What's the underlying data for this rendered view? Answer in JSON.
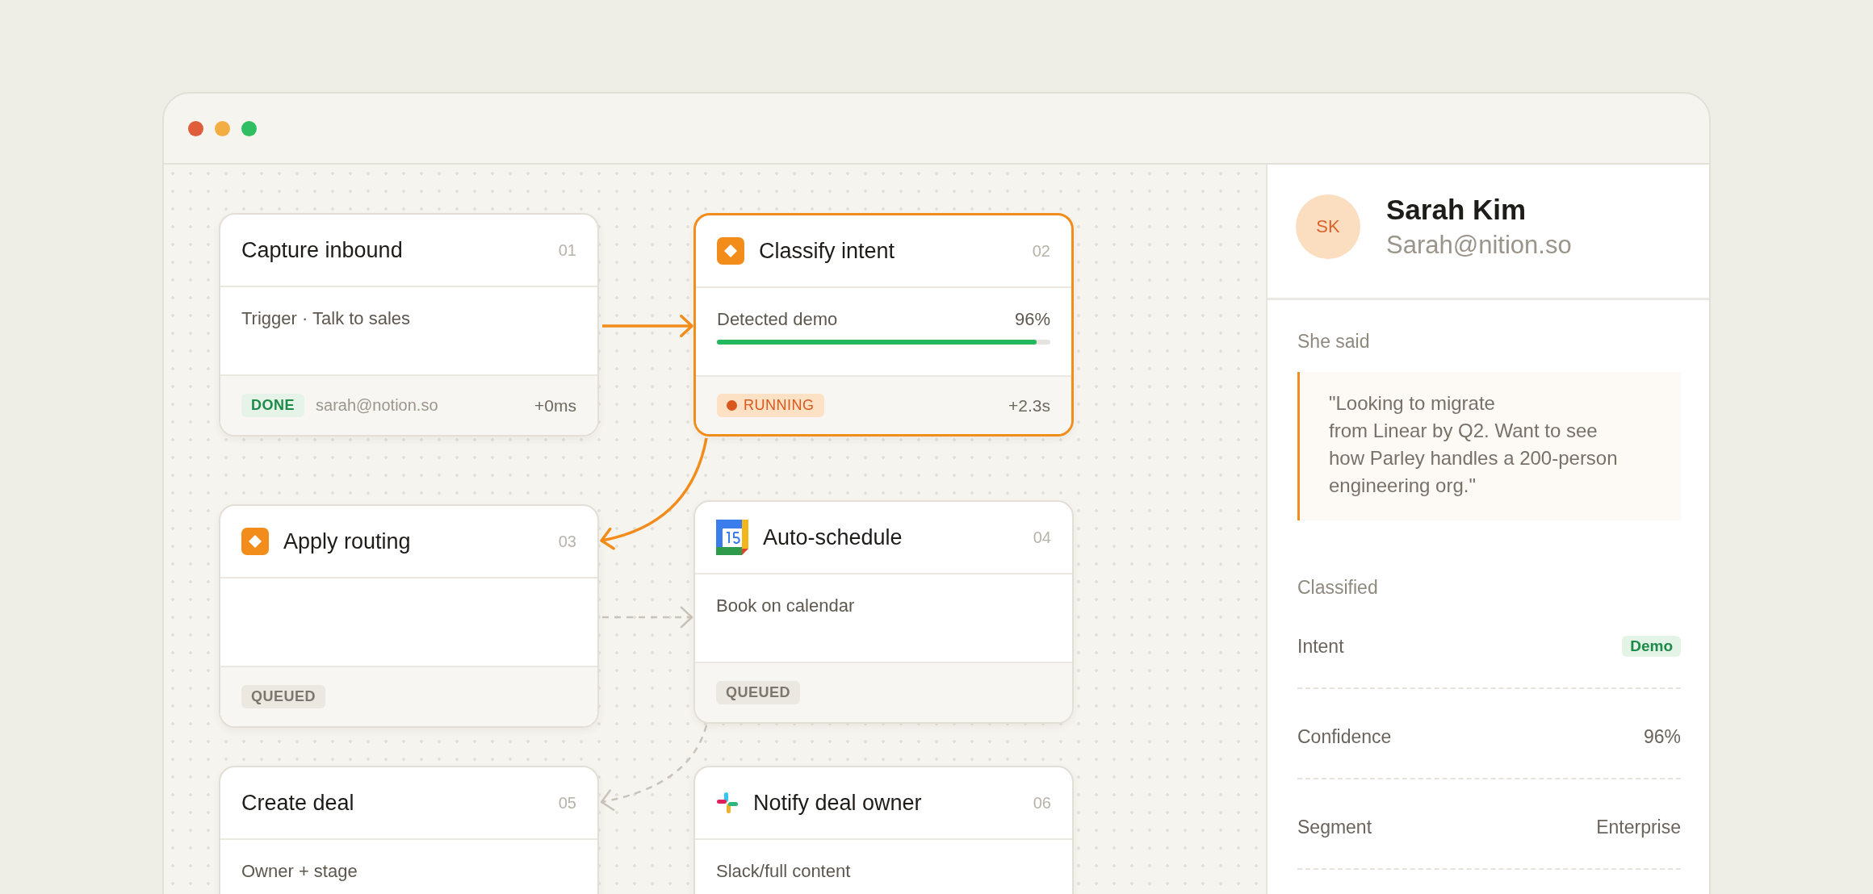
{
  "workflow": {
    "nodes": [
      {
        "number": "01",
        "title": "Capture inbound",
        "kind": "plain",
        "selected": false,
        "body": "Trigger · Talk to sales",
        "status": {
          "label": "DONE",
          "kind": "done"
        },
        "email": "sarah@notion.so",
        "time": "+0ms"
      },
      {
        "number": "02",
        "title": "Classify intent",
        "kind": "rule",
        "selected": true,
        "body": "Detected demo",
        "reading": "96%",
        "level": 0.96,
        "status": {
          "label": "RUNNING",
          "kind": "running"
        },
        "time": "+2.3s"
      },
      {
        "number": "03",
        "title": "Apply routing",
        "kind": "rule",
        "selected": false,
        "status": {
          "label": "QUEUED",
          "kind": "queued"
        }
      },
      {
        "number": "04",
        "title": "Auto-schedule",
        "kind": "calendar",
        "selected": false,
        "body": "Book on calendar",
        "status": {
          "label": "QUEUED",
          "kind": "queued"
        }
      },
      {
        "number": "05",
        "title": "Create deal",
        "kind": "plain",
        "selected": false,
        "body": "Owner + stage"
      },
      {
        "number": "06",
        "title": "Notify deal owner",
        "kind": "chat",
        "selected": false,
        "body": "Slack/full content"
      }
    ],
    "edges": [
      {
        "active": true
      },
      {
        "active": true
      },
      {
        "active": false
      },
      {
        "active": false
      }
    ]
  },
  "panel": {
    "contact": {
      "initials": "SK",
      "name": "Sarah Kim",
      "email": "Sarah@nition.so"
    },
    "quote": {
      "label": "She said",
      "text": "\"Looking to migrate\nfrom Linear by Q2. Want to see how Parley handles a 200-person engineering org.\""
    },
    "classified": {
      "label": "Classified",
      "rows": [
        {
          "label": "Intent",
          "value": "Demo",
          "kind": "tag"
        },
        {
          "label": "Confidence",
          "value": "96%",
          "kind": "text"
        },
        {
          "label": "Segment",
          "value": "Enterprise",
          "kind": "text"
        }
      ]
    }
  }
}
